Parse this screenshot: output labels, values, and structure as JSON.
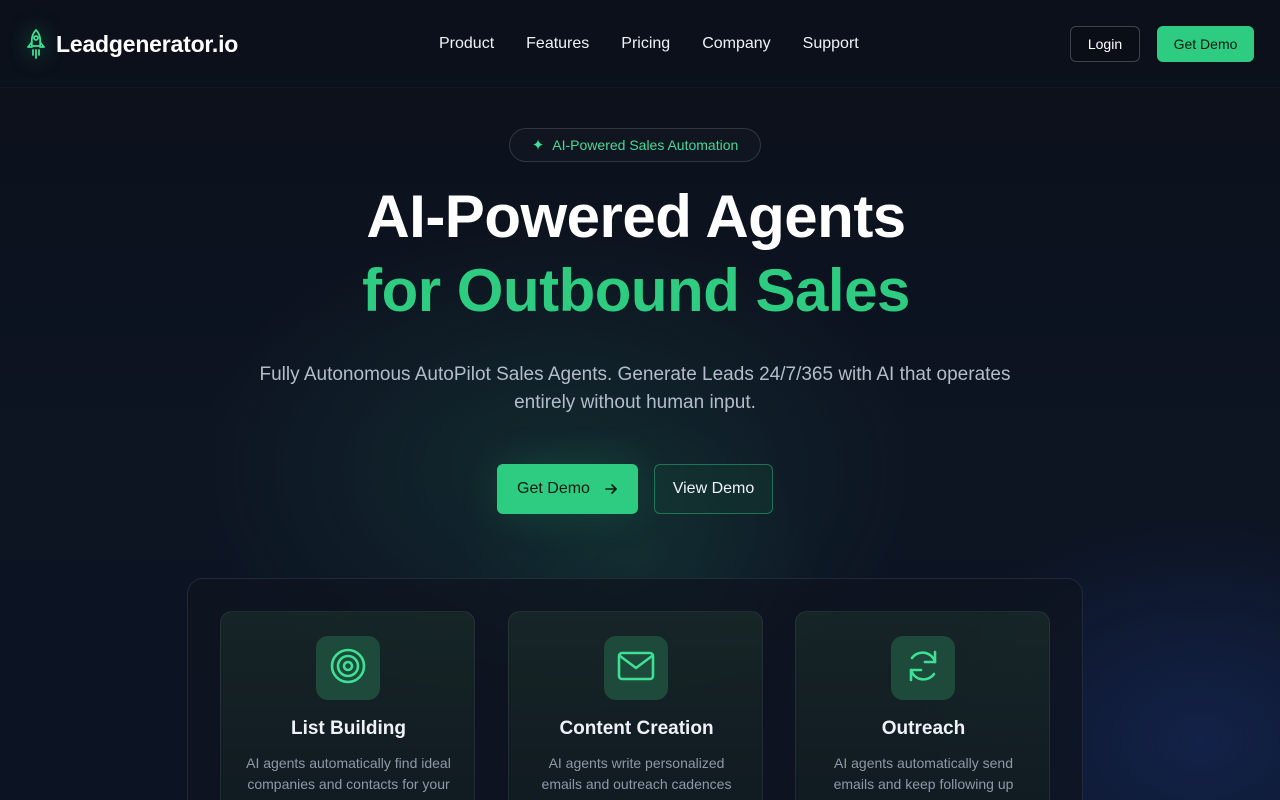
{
  "nav": {
    "brand": "Leadgenerator.io",
    "brand_icon": "rocket-icon",
    "links": [
      "Product",
      "Features",
      "Pricing",
      "Company",
      "Support"
    ],
    "login_label": "Login",
    "get_demo_label": "Get Demo"
  },
  "hero": {
    "badge": "AI-Powered Sales Automation",
    "badge_icon": "sparkle-icon",
    "title_line1": "AI-Powered Agents",
    "title_line2": "for Outbound Sales",
    "subtitle": "Fully Autonomous AutoPilot Sales Agents. Generate Leads 24/7/365 with AI that operates entirely without human input.",
    "primary_cta": "Get Demo",
    "secondary_cta": "View Demo"
  },
  "features": [
    {
      "icon": "target-icon",
      "title": "List Building",
      "description": "AI agents automatically find ideal companies and contacts for your outreach"
    },
    {
      "icon": "mail-icon",
      "title": "Content Creation",
      "description": "AI agents write personalized emails and outreach cadences"
    },
    {
      "icon": "refresh-icon",
      "title": "Outreach",
      "description": "AI agents automatically send emails and keep following up"
    }
  ],
  "colors": {
    "accent": "#2ecc80",
    "background": "#0b101a",
    "icon_box": "#1d4a3a"
  }
}
